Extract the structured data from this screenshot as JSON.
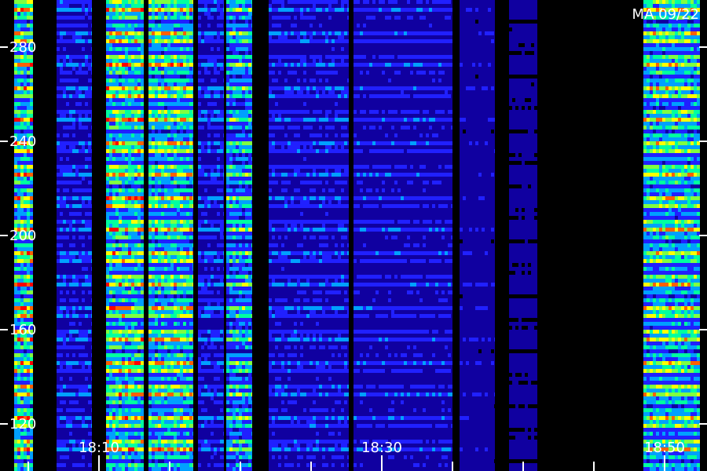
{
  "chart_data": {
    "type": "heatmap",
    "title": "MA 09/22",
    "xlabel": "",
    "ylabel": "",
    "x_axis": {
      "unit": "time",
      "range": [
        "18:03",
        "18:53"
      ],
      "tick_labels": [
        "18:10",
        "18:30",
        "18:50"
      ],
      "major_ticks": [
        "18:10",
        "18:30",
        "18:50"
      ],
      "minor_ticks": [
        "18:05",
        "18:15",
        "18:20",
        "18:25",
        "18:35",
        "18:40",
        "18:45"
      ]
    },
    "y_axis": {
      "range": [
        100,
        300
      ],
      "tick_labels": [
        "120",
        "160",
        "200",
        "240",
        "280"
      ],
      "ticks": [
        120,
        160,
        200,
        240,
        280
      ]
    },
    "colormap": [
      "#000000",
      "#1000a0",
      "#2020ff",
      "#00a0ff",
      "#00ffa0",
      "#80ff40",
      "#ffff00",
      "#ff6000",
      "#ff0000"
    ],
    "grid": false,
    "legend": "none",
    "intensity_bands": [
      {
        "time_start": "18:04:00",
        "time_end": "18:05:20",
        "intensity": 0.85
      },
      {
        "time_start": "18:07:00",
        "time_end": "18:09:30",
        "intensity": 0.35
      },
      {
        "time_start": "18:10:30",
        "time_end": "18:13:10",
        "intensity": 0.82
      },
      {
        "time_start": "18:13:30",
        "time_end": "18:16:40",
        "intensity": 0.78
      },
      {
        "time_start": "18:17:00",
        "time_end": "18:18:50",
        "intensity": 0.35
      },
      {
        "time_start": "18:19:00",
        "time_end": "18:20:50",
        "intensity": 0.62
      },
      {
        "time_start": "18:22:00",
        "time_end": "18:27:40",
        "intensity": 0.32
      },
      {
        "time_start": "18:28:00",
        "time_end": "18:35:00",
        "intensity": 0.28
      },
      {
        "time_start": "18:35:30",
        "time_end": "18:38:00",
        "intensity": 0.18
      },
      {
        "time_start": "18:39:00",
        "time_end": "18:41:00",
        "intensity": 0.12
      },
      {
        "time_start": "18:48:30",
        "time_end": "18:52:30",
        "intensity": 0.75
      }
    ]
  }
}
